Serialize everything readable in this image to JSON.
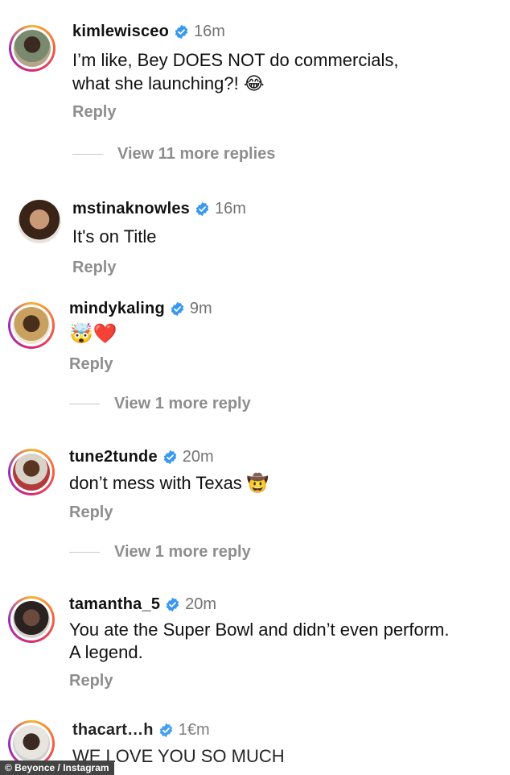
{
  "comments": [
    {
      "username": "kimlewisceo",
      "time": "16m",
      "line1": "I’m like, Bey DOES NOT do commercials,",
      "line2": "what she launching?! 😂",
      "reply": "Reply",
      "more": "View 11 more replies"
    },
    {
      "username": "mstinaknowles",
      "time": "16m",
      "line1": "It's on Title",
      "reply": "Reply"
    },
    {
      "username": "mindykaling",
      "time": "9m",
      "line1": "🤯❤️",
      "reply": "Reply",
      "more": "View 1 more reply"
    },
    {
      "username": "tune2tunde",
      "time": "20m",
      "line1": "don’t mess with Texas 🤠",
      "reply": "Reply",
      "more": "View 1 more reply"
    },
    {
      "username": "tamantha_5",
      "time": "20m",
      "line1": "You ate the Super Bowl and didn’t even perform.",
      "line2": "A legend.",
      "reply": "Reply"
    },
    {
      "username": "thacart…h",
      "time": "1€m",
      "line1": "WE LOVE YOU SO MUCH"
    }
  ],
  "credit": "© Beyonce / Instagram",
  "colors": {
    "verified": "#3897f0",
    "muted": "#8e8e8e"
  },
  "icons": {
    "verified": "verified-badge-icon"
  }
}
